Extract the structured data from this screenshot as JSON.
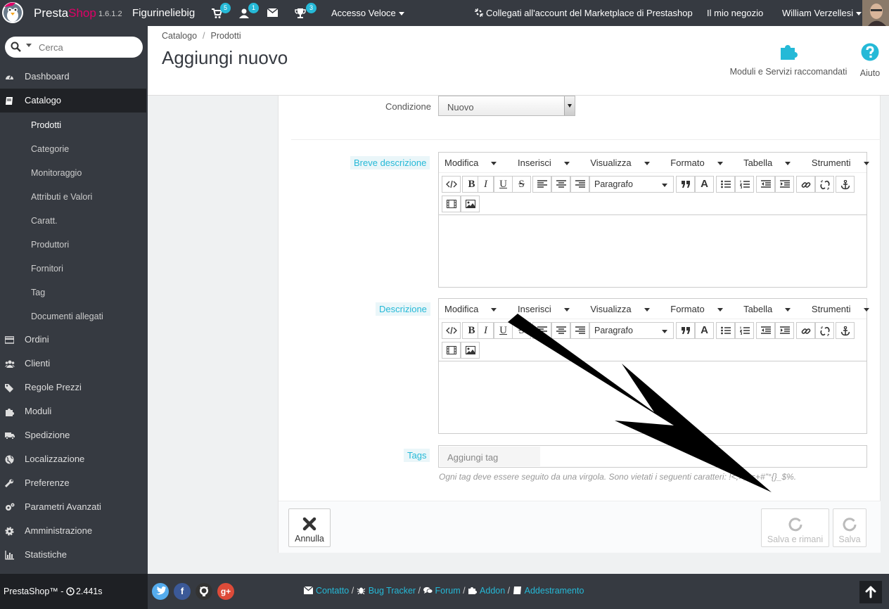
{
  "topbar": {
    "brand_a": "Presta",
    "brand_b": "Shop",
    "version": "1.6.1.2",
    "shop_name": "Figurineliebig",
    "badge_orders": "5",
    "badge_customers": "1",
    "badge_trophy": "3",
    "quick_access": "Accesso Veloce",
    "marketplace": "Collegati all'account del Marketplace di Prestashop",
    "my_shop": "Il mio negozio",
    "user": "William Verzellesi"
  },
  "sidebar": {
    "search_placeholder": "Cerca",
    "menu": [
      {
        "label": "Dashboard"
      },
      {
        "label": "Catalogo"
      },
      {
        "label": "Ordini"
      },
      {
        "label": "Clienti"
      },
      {
        "label": "Regole Prezzi"
      },
      {
        "label": "Moduli"
      },
      {
        "label": "Spedizione"
      },
      {
        "label": "Localizzazione"
      },
      {
        "label": "Preferenze"
      },
      {
        "label": "Parametri Avanzati"
      },
      {
        "label": "Amministrazione"
      },
      {
        "label": "Statistiche"
      }
    ],
    "submenu": [
      {
        "label": "Prodotti"
      },
      {
        "label": "Categorie"
      },
      {
        "label": "Monitoraggio"
      },
      {
        "label": "Attributi e Valori"
      },
      {
        "label": "Caratt."
      },
      {
        "label": "Produttori"
      },
      {
        "label": "Fornitori"
      },
      {
        "label": "Tag"
      },
      {
        "label": "Documenti allegati"
      }
    ]
  },
  "header": {
    "breadcrumb": [
      "Catalogo",
      "Prodotti"
    ],
    "title": "Aggiungi nuovo",
    "modules_label": "Moduli e Servizi raccomandati",
    "help_label": "Aiuto"
  },
  "form": {
    "condition_label": "Condizione",
    "condition_value": "Nuovo",
    "short_desc_label": "Breve descrizione",
    "desc_label": "Descrizione",
    "editor_menus": [
      "Modifica",
      "Inserisci",
      "Visualizza",
      "Formato",
      "Tabella",
      "Strumenti"
    ],
    "format_select": "Paragrafo",
    "tags_label": "Tags",
    "tags_placeholder": "Aggiungi tag",
    "tags_help": "Ogni tag deve essere seguito da una virgola. Sono vietati i seguenti caratteri: !<;>;?=+#\"°{}_$%."
  },
  "actions": {
    "cancel": "Annulla",
    "save_stay": "Salva e rimani",
    "save": "Salva"
  },
  "footer": {
    "copyright": "PrestaShop™ - ",
    "load_time": "2.441s",
    "links": [
      "Contatto",
      "Bug Tracker",
      "Forum",
      "Addon",
      "Addestramento"
    ]
  },
  "colors": {
    "dark": "#363a41",
    "accent": "#25b9d7",
    "brand_pink": "#df0067"
  }
}
